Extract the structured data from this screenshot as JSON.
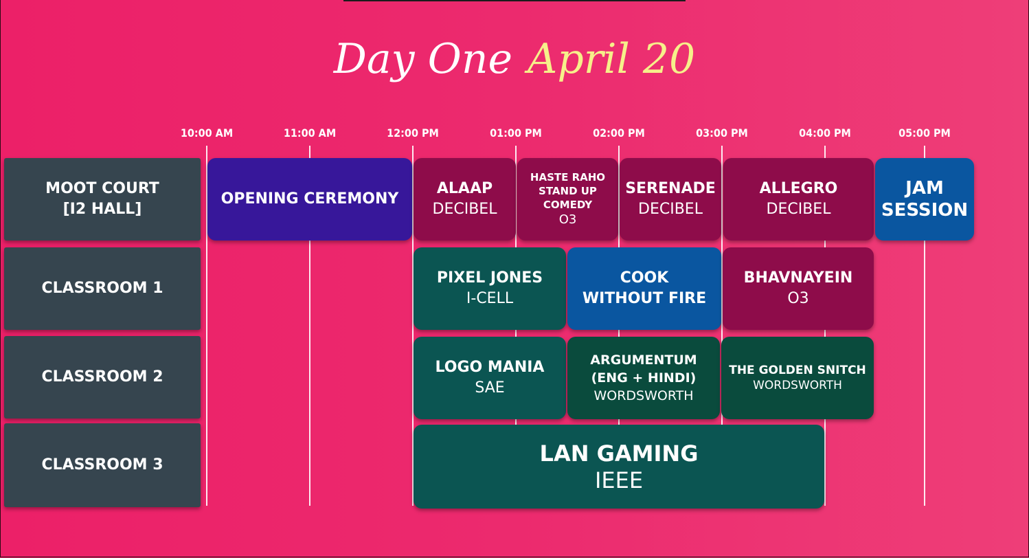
{
  "title": {
    "day": "Day One",
    "date": "April 20"
  },
  "colors": {
    "background": "#ec2068",
    "date_accent": "#f6f08a",
    "room": "#36454f",
    "purple": "#37179a",
    "maroon": "#8e0c4a",
    "blue": "#0a56a0",
    "teal": "#0b5552",
    "dark_green": "#0a4b3d"
  },
  "timeline": [
    "10:00 AM",
    "11:00 AM",
    "12:00 PM",
    "01:00 PM",
    "02:00 PM",
    "03:00 PM",
    "04:00 PM",
    "05:00 PM"
  ],
  "rooms": [
    {
      "name": "MOOT COURT\n[I2 HALL]"
    },
    {
      "name": "CLASSROOM 1"
    },
    {
      "name": "CLASSROOM 2"
    },
    {
      "name": "CLASSROOM 3"
    }
  ],
  "events": [
    {
      "name": "OPENING CEREMONY",
      "club": "",
      "color": "purple"
    },
    {
      "name": "ALAAP",
      "club": "DECIBEL",
      "color": "maroon"
    },
    {
      "name": "HASTE RAHO\nSTAND UP\nCOMEDY",
      "club": "O3",
      "color": "maroon"
    },
    {
      "name": "SERENADE",
      "club": "DECIBEL",
      "color": "maroon"
    },
    {
      "name": "ALLEGRO",
      "club": "DECIBEL",
      "color": "maroon"
    },
    {
      "name": "JAM\nSESSION",
      "club": "",
      "color": "blue"
    },
    {
      "name": "PIXEL JONES",
      "club": "I-CELL",
      "color": "teal"
    },
    {
      "name": "COOK\nWITHOUT FIRE",
      "club": "",
      "color": "blue"
    },
    {
      "name": "BHAVNAYEIN",
      "club": "O3",
      "color": "maroon"
    },
    {
      "name": "LOGO MANIA",
      "club": "SAE",
      "color": "teal"
    },
    {
      "name": "ARGUMENTUM\n(ENG + HINDI)",
      "club": "WORDSWORTH",
      "color": "dark_green"
    },
    {
      "name": "THE GOLDEN SNITCH",
      "club": "WORDSWORTH",
      "color": "dark_green"
    },
    {
      "name": "LAN GAMING",
      "club": "IEEE",
      "color": "teal"
    }
  ]
}
